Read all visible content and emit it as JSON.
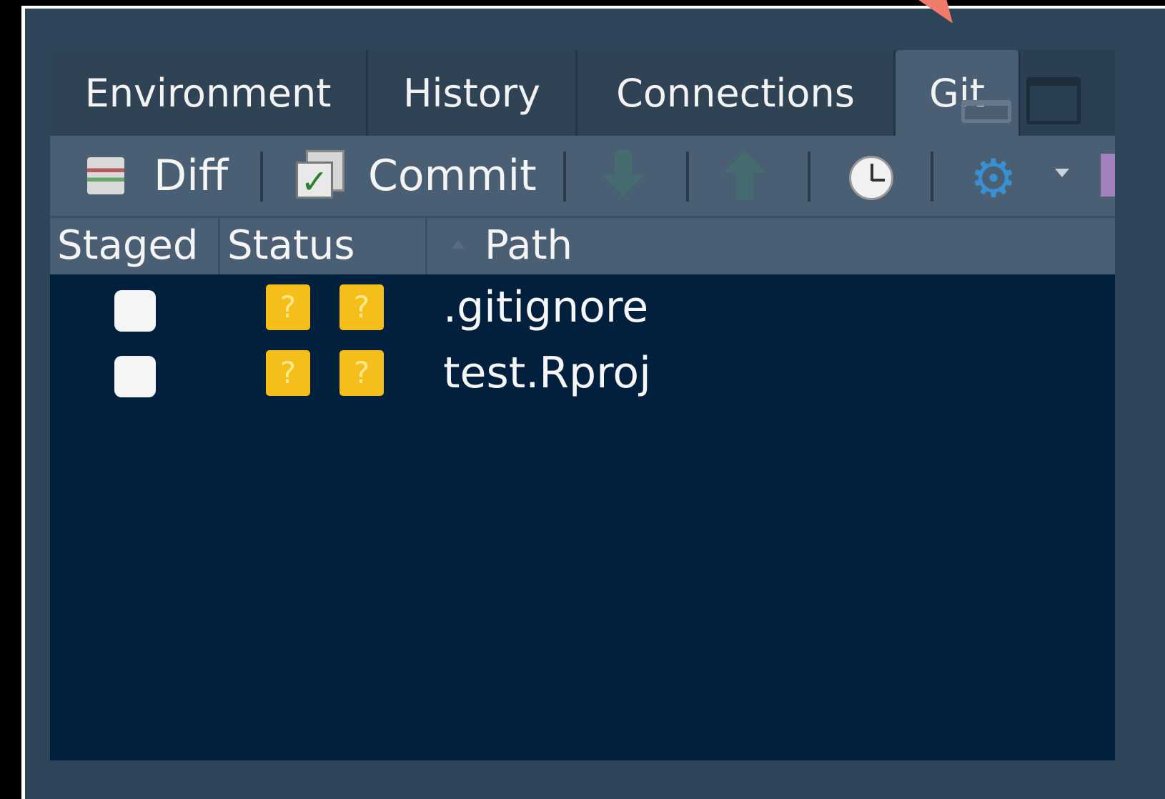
{
  "tabs": [
    {
      "label": "Environment"
    },
    {
      "label": "History"
    },
    {
      "label": "Connections"
    },
    {
      "label": "Git",
      "active": true
    }
  ],
  "toolbar": {
    "diff_label": "Diff",
    "commit_label": "Commit",
    "icons": [
      "diff-icon",
      "commit-icon",
      "pull-icon",
      "push-icon",
      "history-icon",
      "gear-icon",
      "chevron-down-icon"
    ]
  },
  "columns": {
    "staged": "Staged",
    "status": "Status",
    "path": "Path"
  },
  "files": [
    {
      "staged": false,
      "status": [
        "?",
        "?"
      ],
      "path": ".gitignore"
    },
    {
      "staged": false,
      "status": [
        "?",
        "?"
      ],
      "path": "test.Rproj"
    }
  ],
  "colors": {
    "panel_bg": "#2d4459",
    "list_bg": "#01203d",
    "status_untracked": "#f5be1a",
    "annotation_arrow": "#f07a6c"
  }
}
